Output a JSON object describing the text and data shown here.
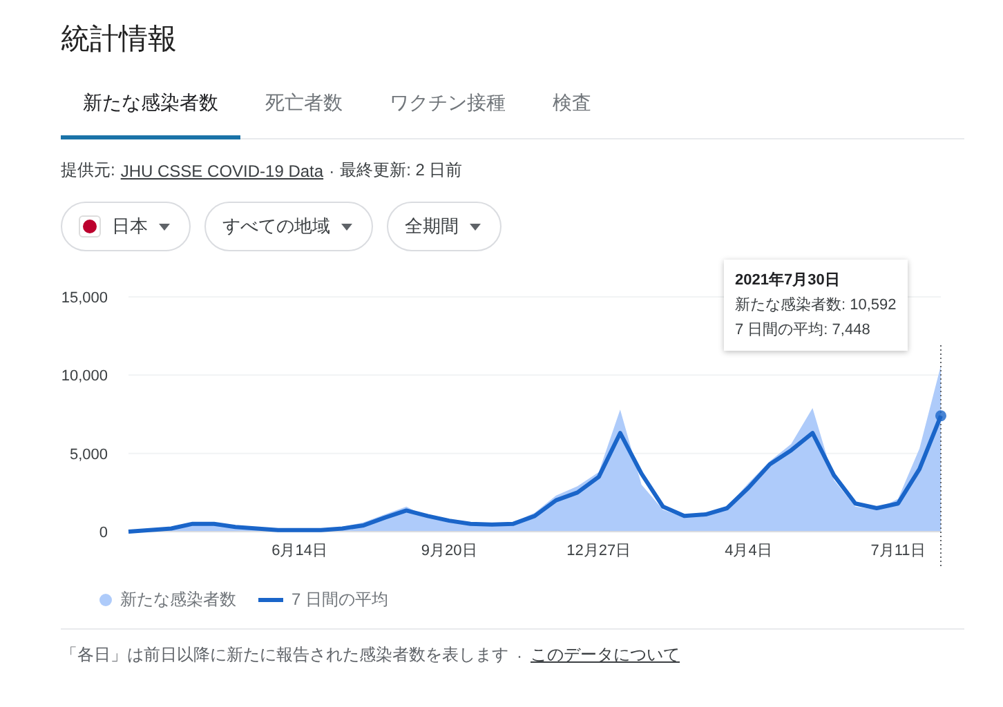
{
  "title": "統計情報",
  "tabs": [
    {
      "label": "新たな感染者数",
      "selected": true
    },
    {
      "label": "死亡者数",
      "selected": false
    },
    {
      "label": "ワクチン接種",
      "selected": false
    },
    {
      "label": "検査",
      "selected": false
    }
  ],
  "source": {
    "prefix": "提供元:",
    "link": "JHU CSSE COVID-19 Data",
    "separator": "·",
    "updated": "最終更新: 2 日前"
  },
  "filters": [
    {
      "label": "日本",
      "kind": "flag"
    },
    {
      "label": "すべての地域",
      "kind": "plain"
    },
    {
      "label": "全期間",
      "kind": "plain"
    }
  ],
  "chart": {
    "chart_data": {
      "type": "area",
      "categories": [
        null,
        null,
        null,
        null,
        null,
        null,
        null,
        null,
        "6月14日",
        null,
        null,
        null,
        null,
        null,
        null,
        "9月20日",
        null,
        null,
        null,
        null,
        null,
        null,
        "12月27日",
        null,
        null,
        null,
        null,
        null,
        null,
        "4月4日",
        null,
        null,
        null,
        null,
        null,
        null,
        "7月11日",
        null,
        null
      ],
      "series": [
        {
          "name": "新たな感染者数",
          "type": "area",
          "color": "#aecbfa",
          "values": [
            0,
            100,
            300,
            600,
            500,
            300,
            100,
            100,
            100,
            100,
            300,
            600,
            1100,
            1600,
            900,
            600,
            500,
            450,
            600,
            1200,
            2300,
            2900,
            3800,
            7800,
            3000,
            1400,
            900,
            1200,
            1600,
            3100,
            4500,
            5600,
            7900,
            3300,
            1600,
            1400,
            2100,
            5300,
            10600
          ]
        },
        {
          "name": "7 日間の平均",
          "type": "line",
          "color": "#1a65c9",
          "values": [
            0,
            100,
            200,
            500,
            500,
            300,
            200,
            100,
            100,
            100,
            200,
            400,
            900,
            1350,
            1000,
            700,
            500,
            450,
            500,
            1000,
            2000,
            2500,
            3500,
            6300,
            3700,
            1600,
            1000,
            1100,
            1500,
            2800,
            4300,
            5200,
            6300,
            3600,
            1800,
            1500,
            1800,
            4000,
            7400
          ]
        }
      ],
      "ylim": [
        0,
        15000
      ],
      "yticks": [
        {
          "value": 15000,
          "label": "15,000"
        },
        {
          "value": 10000,
          "label": "10,000"
        },
        {
          "value": 5000,
          "label": "5,000"
        },
        {
          "value": 0,
          "label": "0"
        }
      ]
    },
    "tooltip": {
      "date": "2021年7月30日",
      "lines": [
        "新たな感染者数: 10,592",
        "7 日間の平均: 7,448"
      ]
    }
  },
  "footer": {
    "text": "「各日」は前日以降に新たに報告された感染者数を表します",
    "separator": "·",
    "link": "このデータについて"
  }
}
